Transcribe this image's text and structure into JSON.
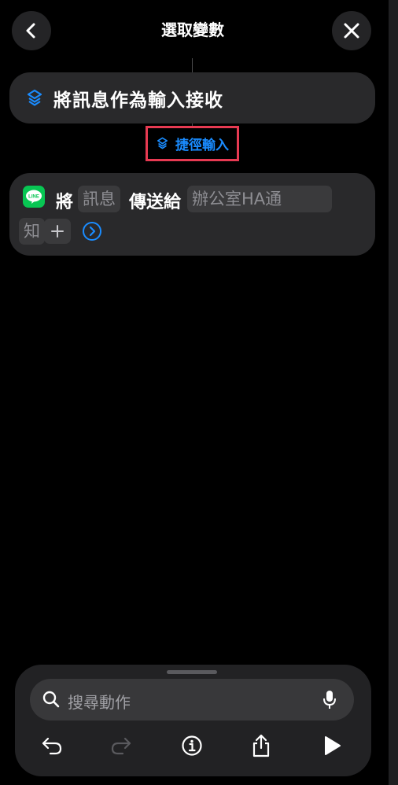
{
  "header": {
    "title": "選取變數"
  },
  "card1": {
    "label": "將訊息作為輸入接收"
  },
  "magic_variable": {
    "label": "捷徑輸入"
  },
  "card2": {
    "word1": "將",
    "token_message": "訊息",
    "word2": "傳送給",
    "token_target_line1": "辦公室HA通",
    "token_target_line2": "知",
    "app_icon_text": "LINE"
  },
  "search": {
    "placeholder": "搜尋動作"
  },
  "colors": {
    "accent": "#1a8cff",
    "highlight": "#e73a52",
    "line_green": "#08c653"
  },
  "icons": [
    "chevron-left-icon",
    "close-icon",
    "shortcuts-icon",
    "line-app-icon",
    "plus-icon",
    "chevron-right-circle-icon",
    "search-icon",
    "microphone-icon",
    "undo-icon",
    "redo-icon",
    "info-icon",
    "share-icon",
    "play-icon"
  ]
}
